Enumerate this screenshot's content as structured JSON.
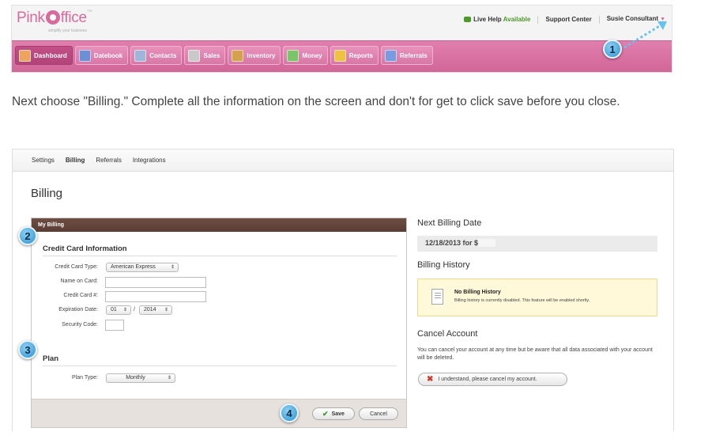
{
  "app": {
    "logo_text_a": "Pink",
    "logo_text_b": "ffice",
    "tagline": "simplify your business",
    "top_links": {
      "live_help": "Live Help",
      "available": "Available",
      "support": "Support Center",
      "user": "Susie Consultant"
    },
    "nav": [
      {
        "label": "Dashboard",
        "icon": "dashboard-icon",
        "color": "#f0a35c"
      },
      {
        "label": "Datebook",
        "icon": "calendar-icon",
        "color": "#6c8fd6"
      },
      {
        "label": "Contacts",
        "icon": "contacts-icon",
        "color": "#9fb6d8"
      },
      {
        "label": "Sales",
        "icon": "sales-register-icon",
        "color": "#c9c9c9"
      },
      {
        "label": "Inventory",
        "icon": "inventory-box-icon",
        "color": "#d4a24a"
      },
      {
        "label": "Money",
        "icon": "money-icon",
        "color": "#7cc46a"
      },
      {
        "label": "Reports",
        "icon": "reports-chart-icon",
        "color": "#f0c040"
      },
      {
        "label": "Referrals",
        "icon": "referrals-people-icon",
        "color": "#7a9be0"
      }
    ]
  },
  "callouts": {
    "one": "1",
    "two": "2",
    "three": "3",
    "four": "4"
  },
  "instruction": "Next choose \"Billing.\"  Complete all the information on the screen and don't for get to click save before you close.",
  "billing": {
    "tabs": [
      "Settings",
      "Billing",
      "Referrals",
      "Integrations"
    ],
    "active_tab": "Billing",
    "title": "Billing",
    "panel_header": "My Billing",
    "credit_card": {
      "section_title": "Credit Card Information",
      "type_label": "Credit Card Type:",
      "type_value": "American Express",
      "name_label": "Name on Card:",
      "number_label": "Credit Card #:",
      "expiration_label": "Expiration Date:",
      "exp_month": "01",
      "exp_year": "2014",
      "exp_separator": "/",
      "security_label": "Security Code:"
    },
    "plan": {
      "section_title": "Plan",
      "type_label": "Plan Type:",
      "type_value": "Monthly"
    },
    "save_label": "Save",
    "cancel_label": "Cancel",
    "next_billing": {
      "title": "Next Billing Date",
      "value": "12/18/2013 for $"
    },
    "history": {
      "title": "Billing History",
      "notice_title": "No Billing History",
      "notice_text": "Billing history is currently disabled. This feature will be enabled shortly."
    },
    "cancel_account": {
      "title": "Cancel Account",
      "text": "You can cancel your account at any time but be aware that all data associated with your account will be deleted.",
      "button": "I understand, please cancel my account."
    }
  }
}
